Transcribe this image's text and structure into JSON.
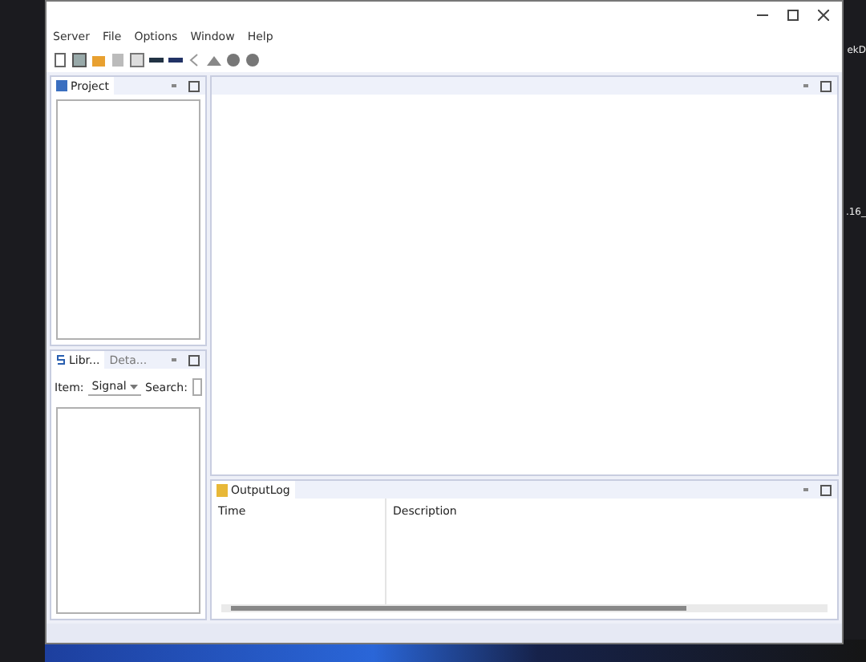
{
  "background_text": [
    "ekD",
    ".16_"
  ],
  "menu": [
    "Server",
    "File",
    "Options",
    "Window",
    "Help"
  ],
  "project_panel": {
    "tabs": [
      {
        "label": "Project",
        "selected": true
      }
    ]
  },
  "library_panel": {
    "tabs": [
      {
        "label": "Libr...",
        "selected": true
      },
      {
        "label": "Deta...",
        "selected": false
      }
    ],
    "item_label": "Item:",
    "item_value": "Signal",
    "search_label": "Search:"
  },
  "output_panel": {
    "tabs": [
      {
        "label": "OutputLog",
        "selected": true
      }
    ],
    "columns": [
      "Time",
      "Description"
    ]
  }
}
